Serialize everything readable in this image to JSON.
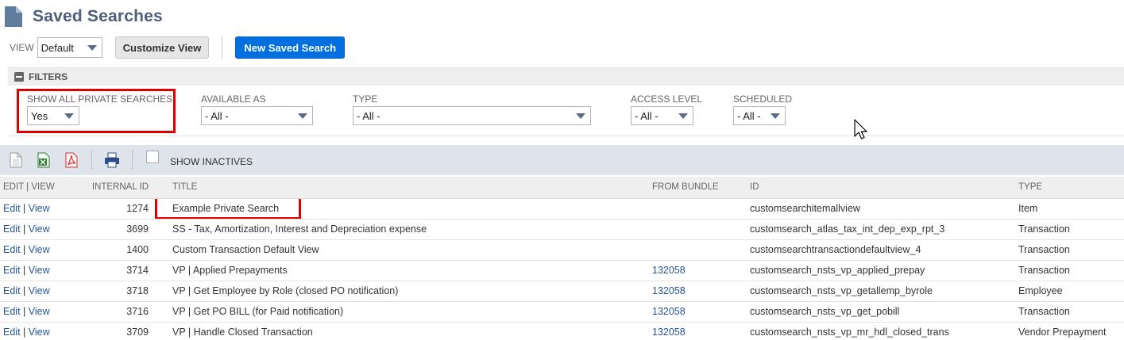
{
  "header": {
    "title": "Saved Searches"
  },
  "view_bar": {
    "view_label": "VIEW",
    "view_value": "Default",
    "customize_label": "Customize View",
    "new_search_label": "New Saved Search"
  },
  "filters": {
    "header_label": "FILTERS",
    "show_private": {
      "label": "SHOW ALL PRIVATE SEARCHES",
      "value": "Yes"
    },
    "available_as": {
      "label": "AVAILABLE AS",
      "value": "- All -"
    },
    "type": {
      "label": "TYPE",
      "value": "- All -"
    },
    "access_level": {
      "label": "ACCESS LEVEL",
      "value": "- All -"
    },
    "scheduled": {
      "label": "SCHEDULED",
      "value": "- All -"
    }
  },
  "toolbar": {
    "show_inactives_label": "SHOW INACTIVES"
  },
  "table": {
    "headers": {
      "edit_view": "EDIT | VIEW",
      "internal_id": "INTERNAL ID",
      "title": "TITLE",
      "from_bundle": "FROM BUNDLE",
      "id": "ID",
      "type": "TYPE"
    },
    "edit_label": "Edit",
    "view_label": "View",
    "rows": [
      {
        "internal_id": "1274",
        "title": "Example Private Search",
        "from_bundle": "",
        "id": "customsearchitemallview",
        "type": "Item"
      },
      {
        "internal_id": "3699",
        "title": "SS - Tax, Amortization, Interest and Depreciation expense",
        "from_bundle": "",
        "id": "customsearch_atlas_tax_int_dep_exp_rpt_3",
        "type": "Transaction"
      },
      {
        "internal_id": "1400",
        "title": "Custom Transaction Default View",
        "from_bundle": "",
        "id": "customsearchtransactiondefaultview_4",
        "type": "Transaction"
      },
      {
        "internal_id": "3714",
        "title": "VP | Applied Prepayments",
        "from_bundle": "132058",
        "id": "customsearch_nsts_vp_applied_prepay",
        "type": "Transaction"
      },
      {
        "internal_id": "3718",
        "title": "VP | Get Employee by Role (closed PO notification)",
        "from_bundle": "132058",
        "id": "customsearch_nsts_vp_getallemp_byrole",
        "type": "Employee"
      },
      {
        "internal_id": "3716",
        "title": "VP | Get PO BILL (for Paid notification)",
        "from_bundle": "132058",
        "id": "customsearch_nsts_vp_get_pobill",
        "type": "Transaction"
      },
      {
        "internal_id": "3709",
        "title": "VP | Handle Closed Transaction",
        "from_bundle": "132058",
        "id": "customsearch_nsts_vp_mr_hdl_closed_trans",
        "type": "Vendor Prepayment"
      }
    ]
  },
  "colors": {
    "title": "#4d5f79",
    "primary_button": "#0070e0",
    "link": "#255599",
    "highlight": "#e00000"
  }
}
